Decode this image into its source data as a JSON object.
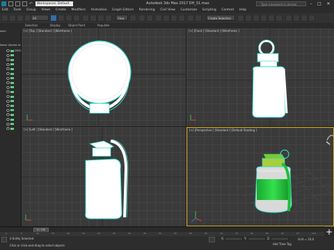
{
  "titlebar": {
    "workspace": "Workspaces: Default",
    "app_title": "Autodesk 3ds Max 2017    DH_51.max",
    "search_placeholder": "Type a keyword or phrase",
    "minimize": "–",
    "maximize": "□",
    "close": "✕"
  },
  "menu": [
    "Edit",
    "Tools",
    "Group",
    "Views",
    "Create",
    "Modifiers",
    "Animation",
    "Graph Editors",
    "Rendering",
    "Civil View",
    "Customize",
    "Scripting",
    "Content",
    "Help"
  ],
  "toolbar": {
    "selection_filter": "All",
    "reference_coord": "View",
    "named_selection": "Create Selection Se"
  },
  "ribbon": {
    "items": [
      "Selection",
      "Display",
      "Object Paint",
      "Populate"
    ]
  },
  "scene_explorer": {
    "header": "elect",
    "root": "Name (Sorted As",
    "rows": [
      "DH51",
      "",
      "",
      "",
      "",
      "",
      "",
      "",
      "",
      "",
      "",
      "",
      "",
      "",
      "",
      "",
      "",
      ""
    ]
  },
  "viewports": {
    "top": "[+] [Top ] [Standard ] [Wireframe ]",
    "front": "[+] [Front ] [Standard ] [Wireframe ]",
    "left": "[+] [Left ] [Standard ] [Wireframe ]",
    "perspective": "[+] [Perspective ] [Standard ] [Default Shading ]"
  },
  "timeline": {
    "slider": "0 / 100",
    "ticks": [
      "0",
      "5",
      "10",
      "15",
      "20",
      "25",
      "30",
      "35",
      "40",
      "45",
      "50",
      "55",
      "60",
      "65",
      "70",
      "75",
      "80",
      "85",
      "90",
      "95",
      "100"
    ]
  },
  "status": {
    "selected": "0 Entity Selected",
    "prompt": "Click or click-and-drag to select objects",
    "x_label": "X:",
    "y_label": "Y:",
    "z_label": "Z:",
    "grid": "Grid = 10,0",
    "add_time_tag": "Add Time Tag"
  },
  "colors": {
    "accent_blue": "#2f6fa8",
    "active_viewport": "#d8b020",
    "grenade_green": "#1fbf3a",
    "wire_cyan": "#2fd7c5"
  }
}
